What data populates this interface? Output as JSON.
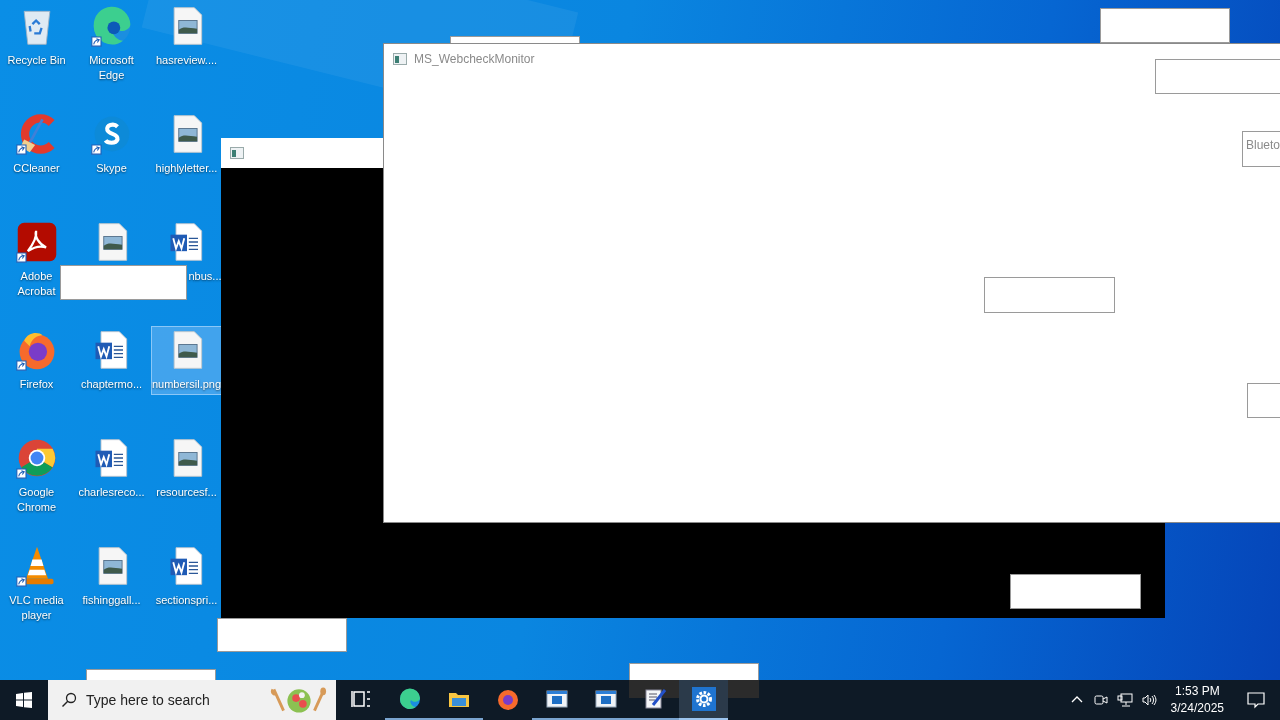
{
  "desktop": {
    "icons": [
      {
        "label": "Recycle Bin",
        "kind": "recycle",
        "shortcut": false,
        "selected": false
      },
      {
        "label": "CCleaner",
        "kind": "ccleaner",
        "shortcut": true,
        "selected": false
      },
      {
        "label": "Adobe Acrobat",
        "kind": "acrobat",
        "shortcut": true,
        "selected": false
      },
      {
        "label": "Firefox",
        "kind": "firefox",
        "shortcut": true,
        "selected": false
      },
      {
        "label": "Google Chrome",
        "kind": "chrome",
        "shortcut": true,
        "selected": false
      },
      {
        "label": "VLC media player",
        "kind": "vlc",
        "shortcut": true,
        "selected": false
      },
      {
        "label": "Microsoft Edge",
        "kind": "edge",
        "shortcut": true,
        "selected": false
      },
      {
        "label": "Skype",
        "kind": "skype",
        "shortcut": true,
        "selected": false
      },
      {
        "kind": "image",
        "shortcut": false,
        "selected": false
      },
      {
        "label": "chaptermo...",
        "kind": "word",
        "shortcut": false,
        "selected": false
      },
      {
        "label": "charlesreco...",
        "kind": "word",
        "shortcut": false,
        "selected": false
      },
      {
        "label": "fishinggall...",
        "kind": "image",
        "shortcut": false,
        "selected": false
      },
      {
        "label": "hasreview....",
        "kind": "image",
        "shortcut": false,
        "selected": false
      },
      {
        "label": "highlyletter...",
        "kind": "image",
        "shortcut": false,
        "selected": false
      },
      {
        "label": "nbus...",
        "kind": "word",
        "shortcut": false,
        "selected": false
      },
      {
        "label": "numbersil.png",
        "kind": "image",
        "shortcut": false,
        "selected": true
      },
      {
        "label": "resourcesf...",
        "kind": "image",
        "shortcut": false,
        "selected": false
      },
      {
        "label": "sectionspri...",
        "kind": "word",
        "shortcut": false,
        "selected": false
      }
    ]
  },
  "windows": [
    {
      "kind": "console"
    },
    {
      "kind": "dialog",
      "title": "MS_WebcheckMonitor",
      "boxes": [
        {
          "kind": "empty"
        },
        {
          "kind": "text",
          "text": "Blueto"
        },
        {
          "kind": "empty"
        },
        {
          "kind": "empty"
        }
      ]
    }
  ],
  "taskbar": {
    "search": {
      "placeholder": "Type here to search"
    },
    "apps": [
      {
        "kind": "taskview",
        "running": false,
        "active": false
      },
      {
        "kind": "edge",
        "running": true,
        "active": false
      },
      {
        "kind": "explorer",
        "running": true,
        "active": false
      },
      {
        "kind": "firefox",
        "running": false,
        "active": false
      },
      {
        "kind": "window",
        "running": true,
        "active": false
      },
      {
        "kind": "window",
        "running": true,
        "active": false
      },
      {
        "kind": "notepad",
        "running": true,
        "active": false
      },
      {
        "kind": "settings",
        "running": true,
        "active": true
      }
    ],
    "clock": {
      "time": "1:53 PM",
      "date": "3/24/2025"
    }
  }
}
